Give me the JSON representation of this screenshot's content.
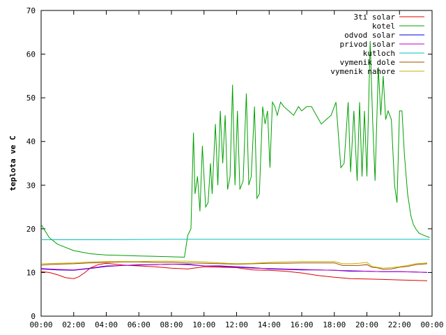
{
  "chart_data": {
    "type": "line",
    "title": "",
    "xlabel": "",
    "ylabel": "teplota ve C",
    "xlim": [
      0,
      24
    ],
    "ylim": [
      0,
      70
    ],
    "x_ticks": [
      {
        "value": 0,
        "label": "00:00"
      },
      {
        "value": 2,
        "label": "02:00"
      },
      {
        "value": 4,
        "label": "04:00"
      },
      {
        "value": 6,
        "label": "06:00"
      },
      {
        "value": 8,
        "label": "08:00"
      },
      {
        "value": 10,
        "label": "10:00"
      },
      {
        "value": 12,
        "label": "12:00"
      },
      {
        "value": 14,
        "label": "14:00"
      },
      {
        "value": 16,
        "label": "16:00"
      },
      {
        "value": 18,
        "label": "18:00"
      },
      {
        "value": 20,
        "label": "20:00"
      },
      {
        "value": 22,
        "label": "22:00"
      },
      {
        "value": 24,
        "label": "00:00"
      }
    ],
    "y_ticks": [
      {
        "value": 0,
        "label": "0"
      },
      {
        "value": 10,
        "label": "10"
      },
      {
        "value": 20,
        "label": "20"
      },
      {
        "value": 30,
        "label": "30"
      },
      {
        "value": 40,
        "label": "40"
      },
      {
        "value": 50,
        "label": "50"
      },
      {
        "value": 60,
        "label": "60"
      },
      {
        "value": 70,
        "label": "70"
      }
    ],
    "grid": false,
    "legend_position": "top-right",
    "series": [
      {
        "name": "3ti solar",
        "color": "#e00000",
        "x": [
          0,
          0.5,
          1,
          1.5,
          2,
          2.3,
          2.7,
          3,
          3.5,
          4,
          5,
          6,
          7,
          8,
          9,
          10,
          11,
          12,
          13,
          14,
          15,
          16,
          17,
          18,
          19,
          20,
          21,
          22,
          23,
          23.7
        ],
        "y": [
          10.2,
          10,
          9.5,
          8.8,
          8.6,
          9,
          10,
          11,
          11.8,
          12.1,
          11.7,
          11.5,
          11.3,
          11,
          10.8,
          11.3,
          11.2,
          11.1,
          10.6,
          10.5,
          10.3,
          9.9,
          9.3,
          8.9,
          8.6,
          8.5,
          8.4,
          8.3,
          8.2,
          8.1
        ]
      },
      {
        "name": "kotel",
        "color": "#00a000",
        "x": [
          0,
          0.5,
          1,
          2,
          3,
          4,
          5,
          6,
          7,
          8,
          8.8,
          9.0,
          9.2,
          9.35,
          9.45,
          9.6,
          9.75,
          9.9,
          10.1,
          10.25,
          10.4,
          10.5,
          10.7,
          10.85,
          11.0,
          11.15,
          11.3,
          11.45,
          11.6,
          11.75,
          11.9,
          12.05,
          12.2,
          12.4,
          12.6,
          12.75,
          12.9,
          13.1,
          13.25,
          13.4,
          13.6,
          13.75,
          13.9,
          14.05,
          14.2,
          14.35,
          14.5,
          14.7,
          14.9,
          15.2,
          15.5,
          15.8,
          16.0,
          16.3,
          16.6,
          16.9,
          17.2,
          17.5,
          17.8,
          18.1,
          18.4,
          18.6,
          18.85,
          19.0,
          19.2,
          19.4,
          19.55,
          19.7,
          19.85,
          20.0,
          20.2,
          20.35,
          20.5,
          20.7,
          20.85,
          21.0,
          21.15,
          21.3,
          21.5,
          21.7,
          21.85,
          22.0,
          22.15,
          22.3,
          22.5,
          22.7,
          22.85,
          23.0,
          23.2,
          23.5,
          23.85
        ],
        "y": [
          21,
          18,
          16.5,
          15,
          14.3,
          14,
          13.9,
          13.8,
          13.7,
          13.6,
          13.5,
          18.5,
          20,
          42,
          28,
          32,
          24,
          39,
          25,
          26,
          35,
          28,
          44,
          30,
          47,
          35,
          46,
          29,
          32,
          53,
          30,
          47,
          29,
          31,
          51,
          30,
          32,
          48,
          27,
          28,
          48,
          44,
          47,
          34,
          49,
          48,
          46,
          49,
          48,
          47,
          46,
          48,
          47,
          48,
          48,
          46,
          44,
          45,
          46,
          49,
          34,
          35,
          49,
          33,
          47,
          31,
          49,
          32,
          47,
          32,
          63,
          45,
          31,
          57,
          46,
          55,
          45,
          47,
          45,
          30,
          26,
          47,
          47,
          37,
          28,
          23,
          21,
          20,
          19,
          18.5,
          18
        ]
      },
      {
        "name": "odvod solar",
        "color": "#0000e0",
        "x": [
          0,
          1,
          2,
          3,
          4,
          5,
          6,
          7,
          8,
          9,
          10,
          11,
          12,
          13,
          14,
          15,
          16,
          17,
          18,
          19,
          20,
          21,
          22,
          23,
          23.7
        ],
        "y": [
          10.8,
          10.6,
          10.5,
          10.9,
          11.4,
          11.6,
          11.7,
          11.8,
          11.9,
          11.9,
          11.5,
          11.5,
          11.3,
          11.1,
          10.8,
          10.7,
          10.6,
          10.6,
          10.5,
          10.3,
          10.3,
          10.2,
          10.2,
          10.1,
          10.0
        ]
      },
      {
        "name": "privod solar",
        "color": "#c000c0",
        "x": [
          0,
          1,
          2,
          3,
          4,
          5,
          6,
          7,
          8,
          9,
          10,
          11,
          12,
          13,
          14,
          15,
          16,
          17,
          18,
          19,
          20,
          21,
          22,
          23,
          23.7
        ],
        "y": [
          10.9,
          10.7,
          10.6,
          11.0,
          11.5,
          11.6,
          11.8,
          11.8,
          11.9,
          11.8,
          11.5,
          11.4,
          11.2,
          11.0,
          10.9,
          10.8,
          10.7,
          10.6,
          10.5,
          10.4,
          10.3,
          10.2,
          10.2,
          10.1,
          10.0
        ]
      },
      {
        "name": "kutloch",
        "color": "#00c0c0",
        "x": [
          0,
          4,
          8,
          12,
          16,
          20,
          23.85
        ],
        "y": [
          17.5,
          17.5,
          17.6,
          17.6,
          17.6,
          17.6,
          17.6
        ]
      },
      {
        "name": "vymenik dole",
        "color": "#a05000",
        "x": [
          0,
          1,
          2,
          3,
          4,
          5,
          6,
          7,
          8,
          9,
          10,
          11,
          12,
          13,
          14,
          15,
          16,
          17,
          18,
          18.5,
          19,
          19.5,
          20,
          20.3,
          20.6,
          21,
          21.5,
          22,
          22.5,
          23,
          23.7
        ],
        "y": [
          11.7,
          11.9,
          12.0,
          12.2,
          12.3,
          12.4,
          12.4,
          12.3,
          12.3,
          12.2,
          12.1,
          12.0,
          11.9,
          12.0,
          12.1,
          12.1,
          12.2,
          12.2,
          12.2,
          11.6,
          11.6,
          11.6,
          11.8,
          11.2,
          11.1,
          10.7,
          10.8,
          11.2,
          11.4,
          11.8,
          12.0
        ]
      },
      {
        "name": "vymenik nahore",
        "color": "#c0b000",
        "x": [
          0,
          1,
          2,
          3,
          4,
          5,
          6,
          7,
          8,
          9,
          10,
          11,
          12,
          13,
          14,
          15,
          16,
          17,
          18,
          18.5,
          19,
          19.5,
          20,
          20.3,
          20.6,
          21,
          21.5,
          22,
          22.5,
          23,
          23.7
        ],
        "y": [
          12.0,
          12.1,
          12.2,
          12.4,
          12.5,
          12.5,
          12.5,
          12.6,
          12.6,
          12.6,
          12.4,
          12.2,
          12.0,
          12.1,
          12.3,
          12.4,
          12.5,
          12.5,
          12.5,
          12.0,
          12.0,
          12.1,
          12.3,
          11.4,
          11.2,
          11.0,
          11.1,
          11.3,
          11.6,
          12.0,
          12.2
        ]
      }
    ]
  }
}
